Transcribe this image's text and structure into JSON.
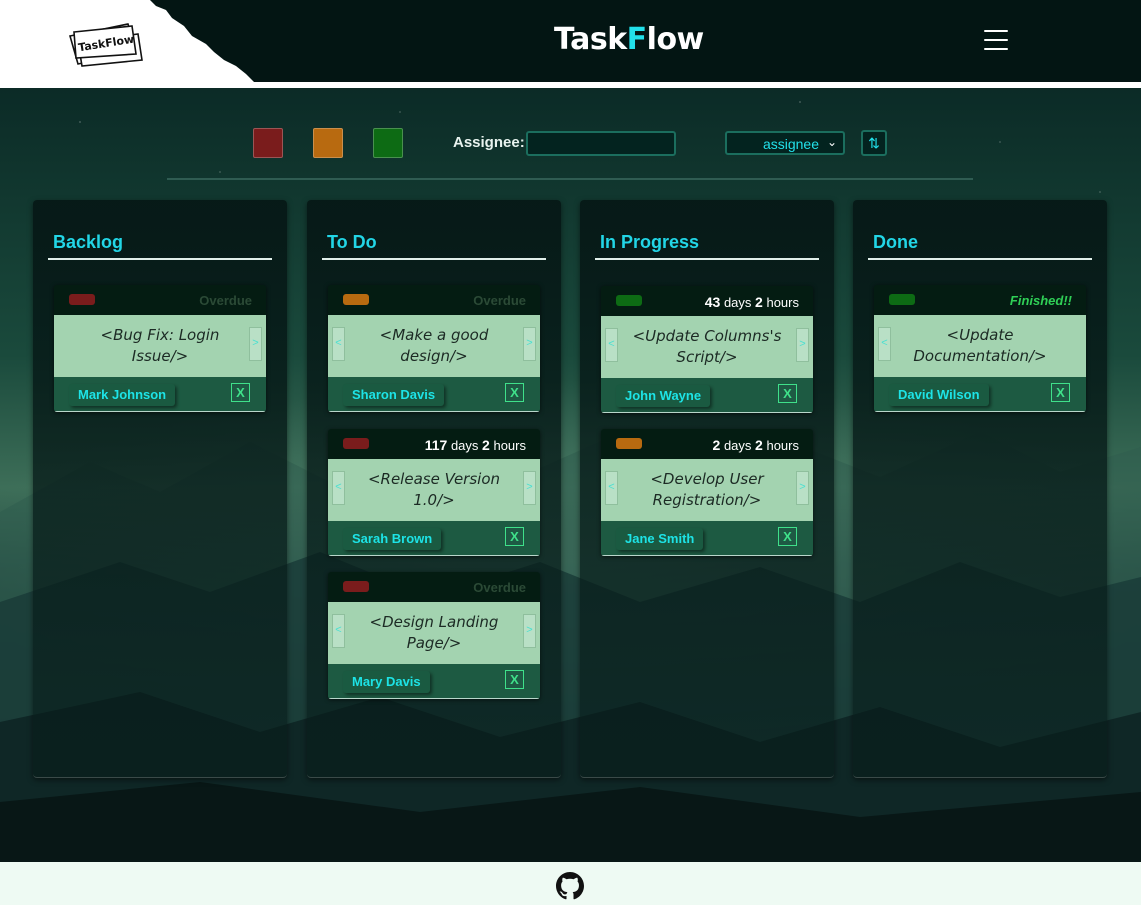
{
  "header": {
    "logo_text": "TaskFlow",
    "brand_prefix": "Task",
    "brand_accent": "F",
    "brand_suffix": "low",
    "menu_icon": "hamburger-icon"
  },
  "toolbar": {
    "priority_filters": [
      {
        "name": "high",
        "color": "#7a1c1c"
      },
      {
        "name": "medium",
        "color": "#b86a10"
      },
      {
        "name": "low",
        "color": "#0d6b14"
      }
    ],
    "assignee_label": "Assignee:",
    "assignee_value": "",
    "sort_value": "assignee",
    "sort_toggle_icon": "sort-arrows-icon",
    "sort_toggle_glyph": "⇅"
  },
  "columns": [
    {
      "title": "Backlog",
      "cards": [
        {
          "priority_color": "#7a1c1c",
          "status": "Overdue",
          "title": "<Bug Fix: Login Issue/>",
          "assignee": "Mark Johnson"
        }
      ]
    },
    {
      "title": "To Do",
      "cards": [
        {
          "priority_color": "#b86a10",
          "status": "Overdue",
          "title": "<Make a good design/>",
          "assignee": "Sharon Davis"
        },
        {
          "priority_color": "#7a1c1c",
          "days": "117",
          "days_unit": "days",
          "hours": "2",
          "hours_unit": "hours",
          "title": "<Release Version 1.0/>",
          "assignee": "Sarah Brown"
        },
        {
          "priority_color": "#7a1c1c",
          "status": "Overdue",
          "title": "<Design Landing Page/>",
          "assignee": "Mary Davis"
        }
      ]
    },
    {
      "title": "In Progress",
      "cards": [
        {
          "priority_color": "#0d6b14",
          "days": "43",
          "days_unit": "days",
          "hours": "2",
          "hours_unit": "hours",
          "title": "<Update Columns's Script/>",
          "assignee": "John Wayne"
        },
        {
          "priority_color": "#b86a10",
          "days": "2",
          "days_unit": "days",
          "hours": "2",
          "hours_unit": "hours",
          "title": "<Develop User Registration/>",
          "assignee": "Jane Smith"
        }
      ]
    },
    {
      "title": "Done",
      "cards": [
        {
          "priority_color": "#0d6b14",
          "status": "Finished!!",
          "title": "<Update Documentation/>",
          "assignee": "David Wilson"
        }
      ]
    }
  ],
  "card_controls": {
    "prev_glyph": "<",
    "next_glyph": ">",
    "delete_label": "X"
  },
  "footer": {
    "icon": "github-icon"
  }
}
